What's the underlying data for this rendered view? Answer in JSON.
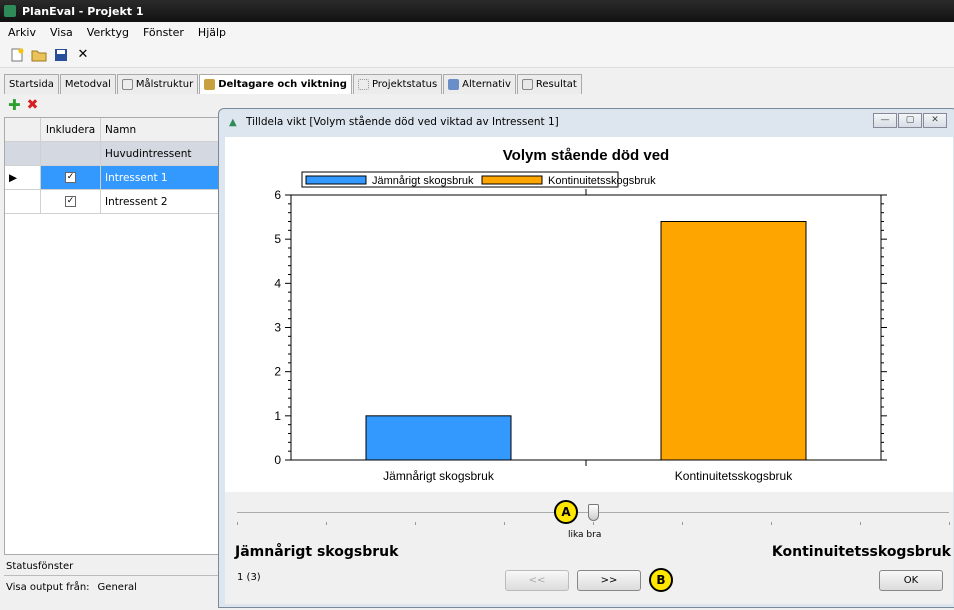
{
  "app": {
    "title": "PlanEval - Projekt 1",
    "menu": [
      "Arkiv",
      "Visa",
      "Verktyg",
      "Fönster",
      "Hjälp"
    ]
  },
  "tabs": [
    {
      "label": "Startsida",
      "icon": "none",
      "active": false
    },
    {
      "label": "Metodval",
      "icon": "none",
      "active": false
    },
    {
      "label": "Målstruktur",
      "icon": "hierarchy-icon",
      "active": false
    },
    {
      "label": "Deltagare och viktning",
      "icon": "people-icon",
      "active": true
    },
    {
      "label": "Projektstatus",
      "icon": "grid-icon",
      "active": false
    },
    {
      "label": "Alternativ",
      "icon": "alternatives-icon",
      "active": false
    },
    {
      "label": "Resultat",
      "icon": "results-icon",
      "active": false
    }
  ],
  "grid": {
    "headers": [
      "",
      "Inkludera",
      "Namn"
    ],
    "rows": [
      {
        "name": "Huvudintressent",
        "checked": false,
        "selected": false,
        "group": true
      },
      {
        "name": "Intressent 1",
        "checked": true,
        "selected": true,
        "group": false
      },
      {
        "name": "Intressent 2",
        "checked": true,
        "selected": false,
        "group": false
      }
    ]
  },
  "status": {
    "label": "Statusfönster",
    "output_label": "Visa output från:",
    "output_value": "General"
  },
  "dialog": {
    "title": "Tilldela vikt [Volym stående död ved viktad av Intressent 1]",
    "slider_label": "lika bra",
    "slider_value": 0.5,
    "left_label": "Jämnårigt skogsbruk",
    "right_label": "Kontinuitetsskogsbruk",
    "page": "1 (3)",
    "prev_label": "<<",
    "next_label": ">>",
    "ok_label": "OK",
    "marker_a": "A",
    "marker_b": "B"
  },
  "chart_data": {
    "type": "bar",
    "title": "Volym stående död ved",
    "categories": [
      "Jämnårigt skogsbruk",
      "Kontinuitetsskogsbruk"
    ],
    "values": [
      1,
      5.4
    ],
    "colors": [
      "#3399ff",
      "#ffa500"
    ],
    "legend": [
      "Jämnårigt skogsbruk",
      "Kontinuitetsskogsbruk"
    ],
    "legend_position": "top-left",
    "ylim": [
      0,
      6
    ],
    "yticks": [
      0,
      1,
      2,
      3,
      4,
      5,
      6
    ]
  }
}
